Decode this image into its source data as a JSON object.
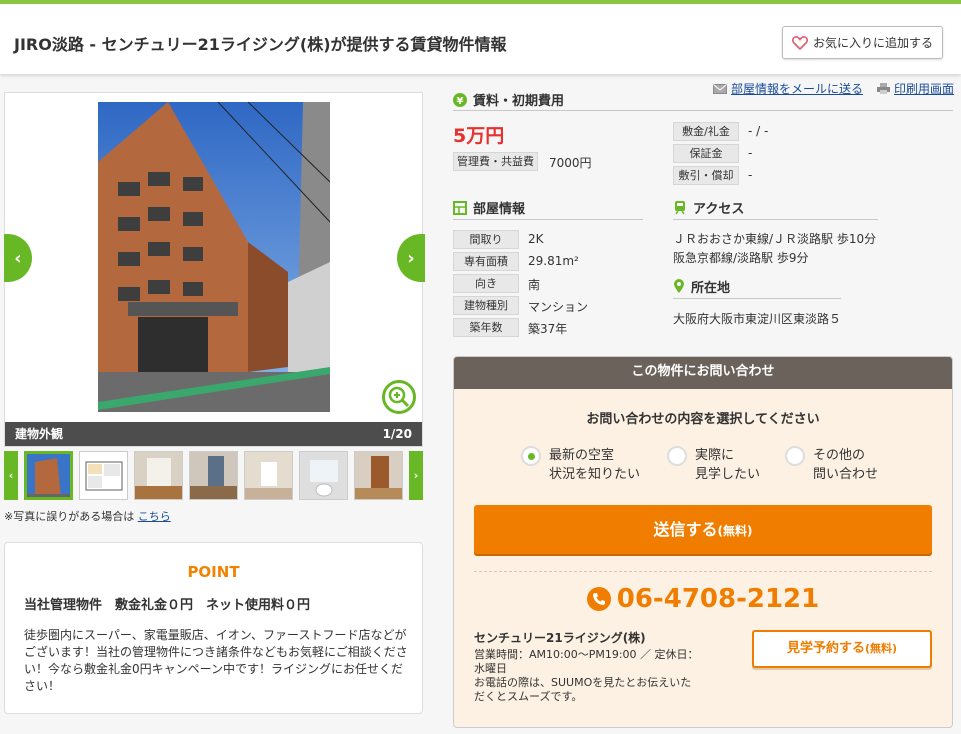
{
  "header": {
    "title": "JIRO淡路 - センチュリー21ライジング(株)が提供する賃貸物件情報",
    "favorite_label": "お気に入りに追加する"
  },
  "gallery": {
    "caption_label": "建物外観",
    "counter": "1/20",
    "prev_arrow": "‹",
    "next_arrow": "›",
    "thumb_prev": "‹",
    "thumb_next": "›",
    "note_text": "※写真に誤りがある場合は",
    "note_link": "こちら"
  },
  "point": {
    "title": "POINT",
    "headline": "当社管理物件　敷金礼金０円　ネット使用料０円",
    "body": "徒歩圏内にスーパー、家電量販店、イオン、ファーストフード店などがございます！当社の管理物件につき諸条件などもお気軽にご相談ください！今なら敷金礼金0円キャンペーン中です！ライジングにお任せください！"
  },
  "links": {
    "email": "部屋情報をメールに送る",
    "print": "印刷用画面"
  },
  "rent": {
    "heading": "賃料・初期費用",
    "price": "5万円",
    "mgmt_label": "管理費・共益費",
    "mgmt_value": "7000円",
    "deposit_label": "敷金/礼金",
    "deposit_value": "- / -",
    "guarantee_label": "保証金",
    "guarantee_value": "-",
    "shikibiki_label": "敷引・償却",
    "shikibiki_value": "-"
  },
  "room": {
    "heading": "部屋情報",
    "rows": [
      {
        "label": "間取り",
        "value": "2K"
      },
      {
        "label": "専有面積",
        "value": "29.81m²"
      },
      {
        "label": "向き",
        "value": "南"
      },
      {
        "label": "建物種別",
        "value": "マンション"
      },
      {
        "label": "築年数",
        "value": "築37年"
      }
    ]
  },
  "access": {
    "heading": "アクセス",
    "line1": "ＪＲおおさか東線/ＪＲ淡路駅 歩10分",
    "line2": "阪急京都線/淡路駅 歩9分"
  },
  "location": {
    "heading": "所在地",
    "address": "大阪府大阪市東淀川区東淡路５"
  },
  "contact": {
    "heading": "この物件にお問い合わせ",
    "prompt": "お問い合わせの内容を選択してください",
    "options": [
      {
        "line1": "最新の空室",
        "line2": "状況を知りたい",
        "selected": true
      },
      {
        "line1": "実際に",
        "line2": "見学したい",
        "selected": false
      },
      {
        "line1": "その他の",
        "line2": "問い合わせ",
        "selected": false
      }
    ],
    "send_label": "送信する",
    "send_suffix": "(無料)",
    "phone": "06-4708-2121",
    "company": "センチュリー21ライジング(株)",
    "hours": "営業時間：AM10:00～PM19:00 ／ 定休日：水曜日",
    "hours_note": "お電話の際は、SUUMOを見たとお伝えいただくとスムーズです。",
    "visit_label": "見学予約する",
    "visit_suffix": "(無料)"
  },
  "colors": {
    "brand_green": "#68b826",
    "accent_orange": "#f07d00",
    "price_red": "#e6312e",
    "link_blue": "#1a4c99"
  }
}
